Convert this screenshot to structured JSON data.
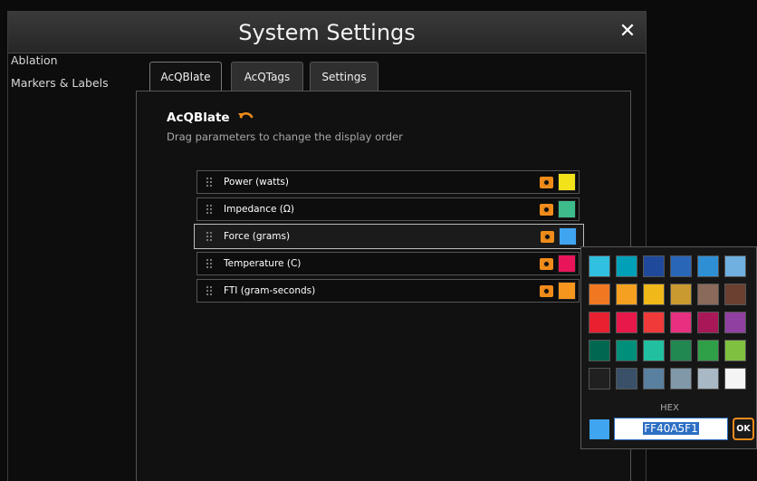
{
  "window": {
    "title": "System Settings",
    "close_symbol": "✕"
  },
  "sidebar": {
    "items": [
      {
        "label": "Ablation"
      },
      {
        "label": "Markers & Labels"
      }
    ]
  },
  "tabs": [
    {
      "label": "AcQBlate",
      "active": true
    },
    {
      "label": "AcQTags",
      "active": false
    },
    {
      "label": "Settings",
      "active": false
    }
  ],
  "section": {
    "title": "AcQBlate",
    "subtitle": "Drag parameters to change the display order",
    "reset_icon": "undo-icon"
  },
  "parameters": [
    {
      "label": "Power (watts)",
      "color": "#f2e21a",
      "visible": true
    },
    {
      "label": "Impedance (Ω)",
      "color": "#3dbb8b",
      "visible": true
    },
    {
      "label": "Force (grams)",
      "color": "#40a5f1",
      "visible": true,
      "selected": true
    },
    {
      "label": "Temperature (C)",
      "color": "#e8155a",
      "visible": true
    },
    {
      "label": "FTI (gram-seconds)",
      "color": "#f5961e",
      "visible": true
    }
  ],
  "color_picker": {
    "palette": [
      [
        "#30c0e0",
        "#00a0b8",
        "#1f4a9c",
        "#2a66b8",
        "#2f8fd4",
        "#6fb0e0"
      ],
      [
        "#f07820",
        "#f5a020",
        "#f0b818",
        "#c89a30",
        "#8a6a5a",
        "#6a4030"
      ],
      [
        "#e82030",
        "#e8184a",
        "#f03a3a",
        "#e83080",
        "#a81858",
        "#9040a0"
      ],
      [
        "#006850",
        "#00907a",
        "#20c0a0",
        "#208850",
        "#30a048",
        "#80c040"
      ],
      [
        "#202020",
        "#3a5068",
        "#5a80a0",
        "#8098a8",
        "#a8b8c4",
        "#f4f4f4"
      ]
    ],
    "hex_label": "HEX",
    "hex_value": "FF40A5F1",
    "preview_color": "#40a5f1",
    "ok_label": "OK"
  },
  "colors": {
    "accent": "#f08c1a"
  }
}
